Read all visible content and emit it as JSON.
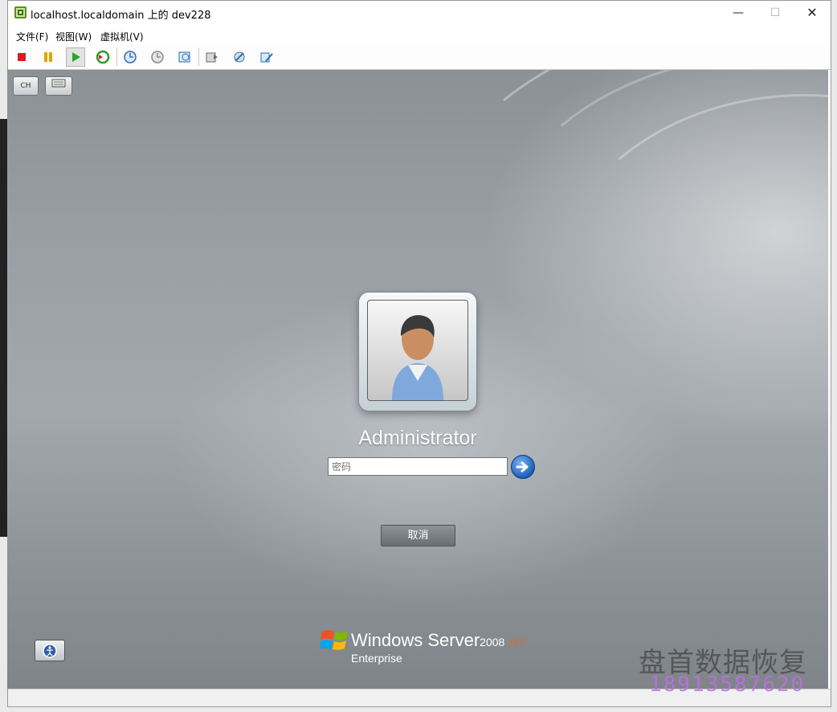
{
  "window": {
    "title": "localhost.localdomain 上的 dev228",
    "controls": {
      "minimize": "—",
      "maximize": "☐",
      "close": "✕"
    }
  },
  "menu": {
    "items": [
      "文件(F)",
      "视图(W)",
      "虚拟机(V)"
    ]
  },
  "toolbar": {
    "buttons": [
      "power-off",
      "pause",
      "power-on",
      "reset",
      "snapshot",
      "revert-snapshot",
      "manage-snapshots",
      "ctrl-alt-del",
      "settings",
      "edit-settings"
    ],
    "pressed": "power-on"
  },
  "vm_screen": {
    "lang_button": "CH",
    "keyboard_icon": "keyboard-icon",
    "username": "Administrator",
    "password_placeholder": "密码",
    "cancel_label": "取消",
    "brand": {
      "product": "Windows Server",
      "year": "2008",
      "release": "R2",
      "edition": "Enterprise"
    }
  },
  "watermark": {
    "company": "盘首数据恢复",
    "phone": "18913587620"
  },
  "colors": {
    "accent_blue": "#1c5fb8",
    "r2_orange": "#e06a2a",
    "watermark_purple": "#be6ee6"
  }
}
